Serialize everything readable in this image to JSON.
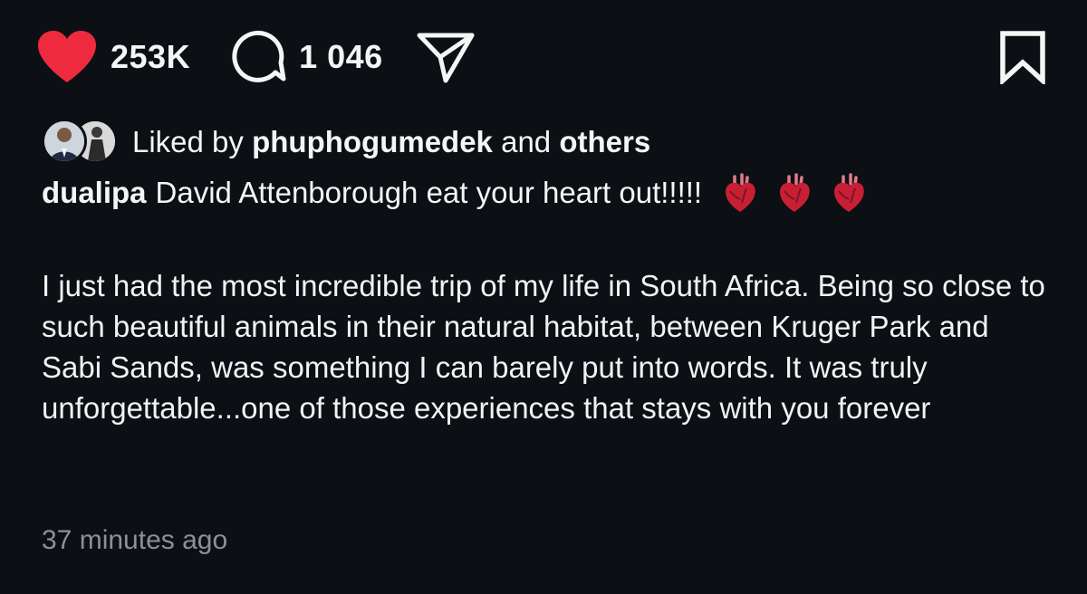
{
  "actions": {
    "likes_count": "253K",
    "comments_count": "1 046",
    "like_icon": "heart-filled-icon",
    "comment_icon": "comment-bubble-icon",
    "share_icon": "paper-plane-icon",
    "save_icon": "bookmark-icon",
    "like_color": "#ee2a3f"
  },
  "likes": {
    "prefix": "Liked by",
    "user": "phuphogumedek",
    "and_text": "and",
    "others": "others"
  },
  "caption": {
    "username": "dualipa",
    "first_line": "David Attenborough eat your heart out!!!!!",
    "emoji": "anatomical-heart-icon",
    "body": "I just had the most incredible trip of my life in South Africa. Being so close to such beautiful animals in their natural habitat, between Kruger Park and Sabi Sands, was something I can barely put into words. It was truly unforgettable...one of those experiences that stays with you forever"
  },
  "timestamp": "37 minutes ago"
}
